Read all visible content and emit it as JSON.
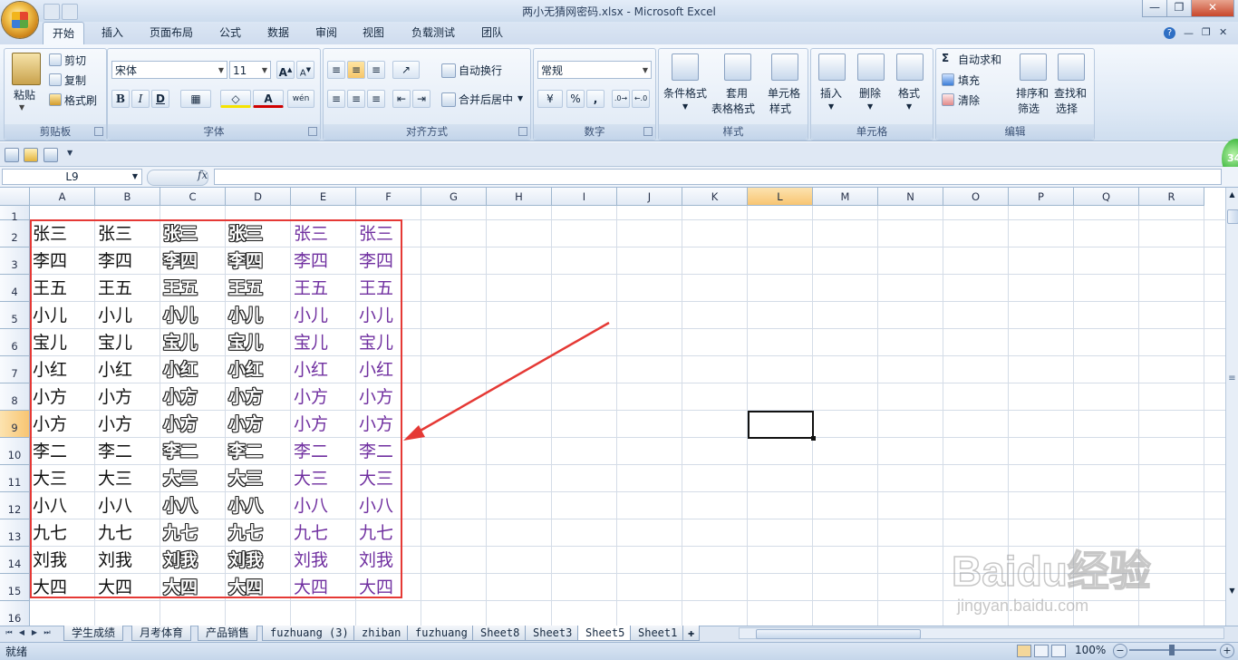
{
  "window": {
    "title": "两小无猜网密码.xlsx - Microsoft Excel",
    "buttons": {
      "minimize": "—",
      "restore": "❐",
      "close": "✕"
    }
  },
  "ribbon_tabs": [
    "开始",
    "插入",
    "页面布局",
    "公式",
    "数据",
    "审阅",
    "视图",
    "负载测试",
    "团队"
  ],
  "active_tab": "开始",
  "clipboard": {
    "paste": "粘贴",
    "cut": "剪切",
    "copy": "复制",
    "format_painter": "格式刷",
    "group": "剪贴板"
  },
  "font": {
    "name": "宋体",
    "size": "11",
    "grow": "A",
    "shrink": "A",
    "bold": "B",
    "italic": "I",
    "underline": "D",
    "font_color": "A",
    "phonetic": "wén",
    "group": "字体"
  },
  "alignment": {
    "wrap_text": "自动换行",
    "merge_center": "合并后居中",
    "group": "对齐方式"
  },
  "number": {
    "format": "常规",
    "percent": "%",
    "comma": ",",
    "group": "数字"
  },
  "styles": {
    "conditional": "条件格式",
    "table1": "套用",
    "table2": "表格格式",
    "cell1": "单元格",
    "cell2": "样式",
    "group": "样式"
  },
  "cells": {
    "insert": "插入",
    "delete": "删除",
    "format": "格式",
    "group": "单元格"
  },
  "editing": {
    "autosum": "自动求和",
    "fill": "填充",
    "clear": "清除",
    "sort1": "排序和",
    "sort2": "筛选",
    "find1": "查找和",
    "find2": "选择",
    "group": "编辑"
  },
  "formula_bar": {
    "name_box": "L9",
    "fx": "fx",
    "content": ""
  },
  "badge": "34",
  "columns": [
    "A",
    "B",
    "C",
    "D",
    "E",
    "F",
    "G",
    "H",
    "I",
    "J",
    "K",
    "L",
    "M",
    "N",
    "O",
    "P",
    "Q",
    "R"
  ],
  "selected_column": "L",
  "rows": [
    "1",
    "2",
    "3",
    "4",
    "5",
    "6",
    "7",
    "8",
    "9",
    "10",
    "11",
    "12",
    "13",
    "14",
    "15",
    "16"
  ],
  "selected_row": "9",
  "names": [
    "张三",
    "李四",
    "王五",
    "小儿",
    "宝儿",
    "小红",
    "小方",
    "小方",
    "李二",
    "大三",
    "小八",
    "九七",
    "刘我",
    "大四"
  ],
  "sheet_tabs": [
    "学生成绩",
    "月考体育",
    "产品销售",
    "fuzhuang (3)",
    "zhiban",
    "fuzhuang",
    "Sheet8",
    "Sheet3",
    "Sheet5",
    "Sheet1"
  ],
  "active_sheet": "Sheet5",
  "status": {
    "ready": "就绪",
    "zoom": "100%"
  },
  "watermark": {
    "brand": "Baidu经验",
    "url": "jingyan.baidu.com"
  },
  "colors": {
    "annotation": "#e53935",
    "purple_text": "#7030a0"
  }
}
